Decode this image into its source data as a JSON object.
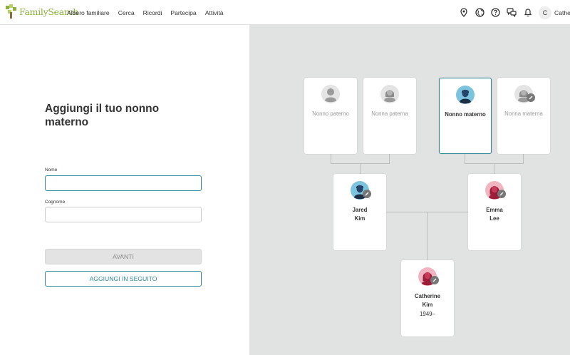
{
  "header": {
    "logo_text": "FamilySearch",
    "nav": [
      "Albero familiare",
      "Cerca",
      "Ricordi",
      "Partecipa",
      "Attività"
    ],
    "user_initial": "C",
    "user_name": "Catherine"
  },
  "form": {
    "title": "Aggiungi il tuo nonno materno",
    "first_name_label": "Nome",
    "first_name_value": "",
    "last_name_label": "Cognome",
    "last_name_value": "",
    "next_button": "AVANTI",
    "later_button": "AGGIUNGI IN SEGUITO"
  },
  "tree": {
    "paternal_grandfather": "Nonno paterno",
    "paternal_grandmother": "Nonna paterna",
    "maternal_grandfather": "Nonno materno",
    "maternal_grandmother": "Nonna materna",
    "father": {
      "first": "Jared",
      "last": "Kim"
    },
    "mother": {
      "first": "Emma",
      "last": "Lee"
    },
    "self": {
      "first": "Catherine",
      "last": "Kim",
      "years": "1949–"
    }
  },
  "colors": {
    "accent": "#2d8a99",
    "brand_green": "#8cb03e",
    "panel_bg": "#e1e3e3"
  }
}
